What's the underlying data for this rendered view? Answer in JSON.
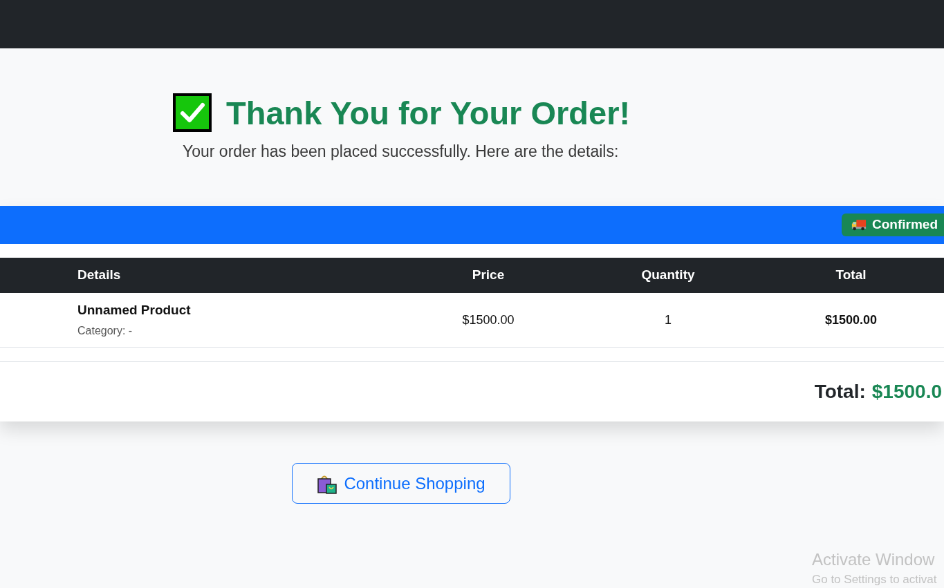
{
  "hero": {
    "title": "Thank You for Your Order!",
    "subtitle": "Your order has been placed successfully. Here are the details:"
  },
  "order_card": {
    "status_badge": {
      "label": "Confirmed"
    },
    "table": {
      "columns": [
        "Details",
        "Price",
        "Quantity",
        "Total"
      ],
      "rows": [
        {
          "product": "Unnamed Product",
          "category": "Category: -",
          "price": "$1500.00",
          "quantity": "1",
          "total": "$1500.00"
        }
      ]
    },
    "grand_total": {
      "label": "Total:",
      "amount": "$1500.0"
    }
  },
  "continue_button": {
    "label": "Continue Shopping"
  },
  "os_notice": {
    "title": "Activate Window",
    "subtitle": "Go to Settings to activat"
  }
}
